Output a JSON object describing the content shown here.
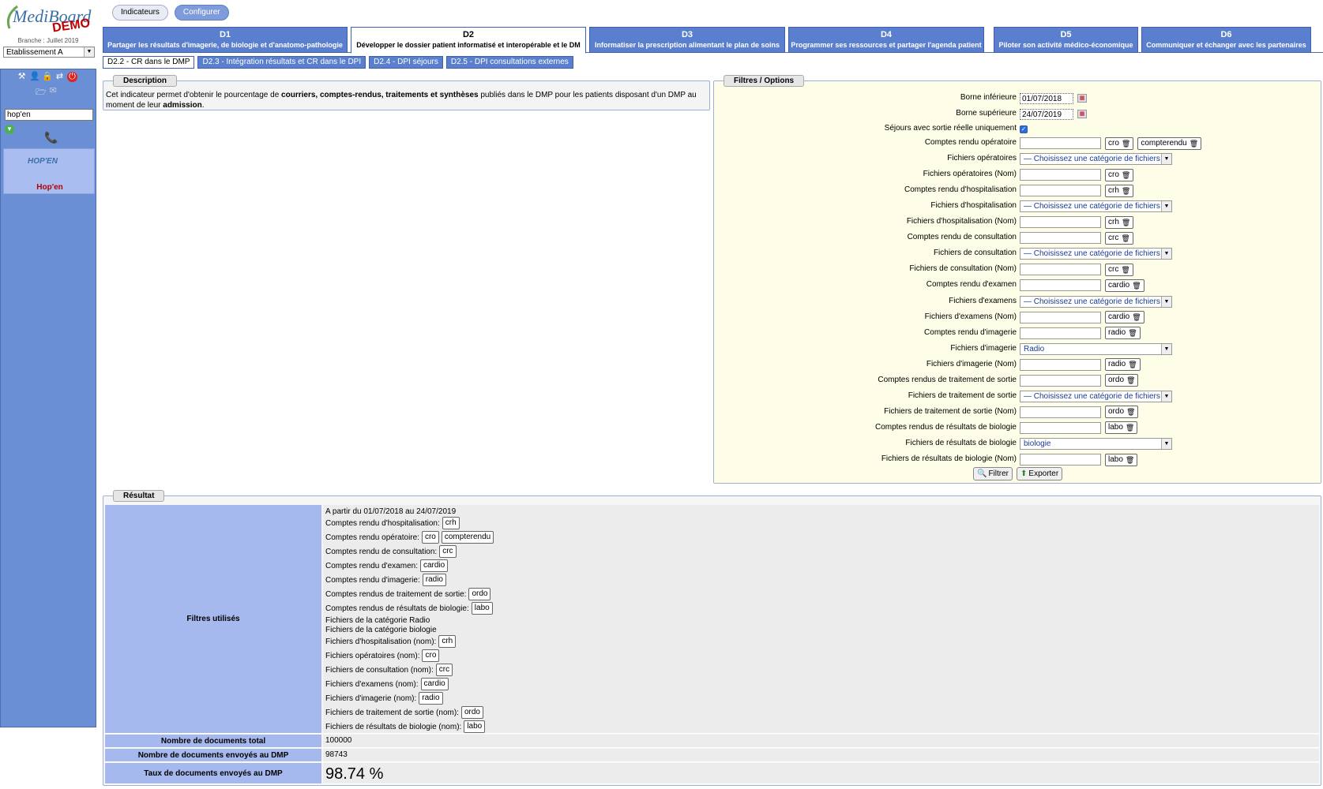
{
  "sidebar": {
    "logo_text": "MediBoard",
    "logo_demo": "DEMO",
    "branch": "Branche : Juillet 2019",
    "etablissement": "Etablissement A",
    "search_value": "hop'en",
    "hopen_logo": "HOP'EN",
    "hopen_name": "Hop'en"
  },
  "top_buttons": {
    "indicateurs": "Indicateurs",
    "configurer": "Configurer"
  },
  "domain_tabs": [
    {
      "code": "D1",
      "label": "Partager les résultats d'imagerie, de biologie et d'anatomo-pathologie"
    },
    {
      "code": "D2",
      "label": "Développer le dossier patient informatisé et interopérable et le DM"
    },
    {
      "code": "D3",
      "label": "Informatiser la prescription alimentant le plan de soins"
    },
    {
      "code": "D4",
      "label": "Programmer ses ressources et partager l'agenda patient"
    },
    {
      "code": "D5",
      "label": "Piloter son activité médico-économique"
    },
    {
      "code": "D6",
      "label": "Communiquer et échanger avec les partenaires"
    }
  ],
  "sub_tabs": [
    "D2.2 - CR dans le DMP",
    "D2.3 - Intégration résultats et CR dans le DPI",
    "D2.4 - DPI séjours",
    "D2.5 - DPI consultations externes"
  ],
  "description": {
    "legend": "Description",
    "text_1": "Cet indicateur permet d'obtenir le pourcentage de ",
    "text_bold_1": "courriers, comptes-rendus, traitements et synthèses",
    "text_2": " publiés dans le DMP pour les patients disposant d'un DMP au moment de leur ",
    "text_bold_2": "admission",
    "text_3": "."
  },
  "filters": {
    "legend": "Filtres / Options",
    "borne_inf_label": "Borne inférieure",
    "borne_inf_value": "01/07/2018",
    "borne_sup_label": "Borne supérieure",
    "borne_sup_value": "24/07/2019",
    "sejours_label": "Séjours avec sortie réelle uniquement",
    "select_placeholder": "— Choisissez une catégorie de fichiers",
    "rows": [
      {
        "label": "Comptes rendu opératoire",
        "tags": [
          "cro",
          "compterendu"
        ]
      },
      {
        "label": "Fichiers opératoires",
        "select": "— Choisissez une catégorie de fichiers"
      },
      {
        "label": "Fichiers opératoires (Nom)",
        "tags": [
          "cro"
        ]
      },
      {
        "label": "Comptes rendu d'hospitalisation",
        "tags": [
          "crh"
        ]
      },
      {
        "label": "Fichiers d'hospitalisation",
        "select": "— Choisissez une catégorie de fichiers"
      },
      {
        "label": "Fichiers d'hospitalisation (Nom)",
        "tags": [
          "crh"
        ]
      },
      {
        "label": "Comptes rendu de consultation",
        "tags": [
          "crc"
        ]
      },
      {
        "label": "Fichiers de consultation",
        "select": "— Choisissez une catégorie de fichiers"
      },
      {
        "label": "Fichiers de consultation (Nom)",
        "tags": [
          "crc"
        ]
      },
      {
        "label": "Comptes rendu d'examen",
        "tags": [
          "cardio"
        ]
      },
      {
        "label": "Fichiers d'examens",
        "select": "— Choisissez une catégorie de fichiers"
      },
      {
        "label": "Fichiers d'examens (Nom)",
        "tags": [
          "cardio"
        ]
      },
      {
        "label": "Comptes rendu d'imagerie",
        "tags": [
          "radio"
        ]
      },
      {
        "label": "Fichiers d'imagerie",
        "select": "Radio"
      },
      {
        "label": "Fichiers d'imagerie (Nom)",
        "tags": [
          "radio"
        ]
      },
      {
        "label": "Comptes rendus de traitement de sortie",
        "tags": [
          "ordo"
        ]
      },
      {
        "label": "Fichiers de traitement de sortie",
        "select": "— Choisissez une catégorie de fichiers"
      },
      {
        "label": "Fichiers de traitement de sortie (Nom)",
        "tags": [
          "ordo"
        ]
      },
      {
        "label": "Comptes rendus de résultats de biologie",
        "tags": [
          "labo"
        ]
      },
      {
        "label": "Fichiers de résultats de biologie",
        "select": "biologie"
      },
      {
        "label": "Fichiers de résultats de biologie (Nom)",
        "tags": [
          "labo"
        ]
      }
    ],
    "filtrer_label": "Filtrer",
    "exporter_label": "Exporter"
  },
  "result": {
    "legend": "Résultat",
    "filtres_label": "Filtres utilisés",
    "filtres_lines": [
      {
        "text": "A partir du 01/07/2018 au 24/07/2019",
        "tags": []
      },
      {
        "text": "Comptes rendu d'hospitalisation:",
        "tags": [
          "crh"
        ]
      },
      {
        "text": "Comptes rendu opératoire:",
        "tags": [
          "cro",
          "compterendu"
        ]
      },
      {
        "text": "Comptes rendu de consultation:",
        "tags": [
          "crc"
        ]
      },
      {
        "text": "Comptes rendu d'examen:",
        "tags": [
          "cardio"
        ]
      },
      {
        "text": "Comptes rendu d'imagerie:",
        "tags": [
          "radio"
        ]
      },
      {
        "text": "Comptes rendus de traitement de sortie:",
        "tags": [
          "ordo"
        ]
      },
      {
        "text": "Comptes rendus de résultats de biologie:",
        "tags": [
          "labo"
        ]
      },
      {
        "text": "Fichiers de la catégorie Radio",
        "tags": []
      },
      {
        "text": "Fichiers de la catégorie biologie",
        "tags": []
      },
      {
        "text": "Fichiers d'hospitalisation (nom):",
        "tags": [
          "crh"
        ]
      },
      {
        "text": "Fichiers opératoires (nom):",
        "tags": [
          "cro"
        ]
      },
      {
        "text": "Fichiers de consultation (nom):",
        "tags": [
          "crc"
        ]
      },
      {
        "text": "Fichiers d'examens (nom):",
        "tags": [
          "cardio"
        ]
      },
      {
        "text": "Fichiers d'imagerie (nom):",
        "tags": [
          "radio"
        ]
      },
      {
        "text": "Fichiers de traitement de sortie (nom):",
        "tags": [
          "ordo"
        ]
      },
      {
        "text": "Fichiers de résultats de biologie (nom):",
        "tags": [
          "labo"
        ]
      }
    ],
    "total_label": "Nombre de documents total",
    "total_value": "100000",
    "envoyes_label": "Nombre de documents envoyés au DMP",
    "envoyes_value": "98743",
    "taux_label": "Taux de documents envoyés au DMP",
    "taux_value": "98.74 %"
  },
  "colors": {
    "sidebar": "#6b8fd4",
    "tab": "#5b7fcf",
    "result_header": "#a6b9ee",
    "filters_bg": "#fdfde8"
  }
}
